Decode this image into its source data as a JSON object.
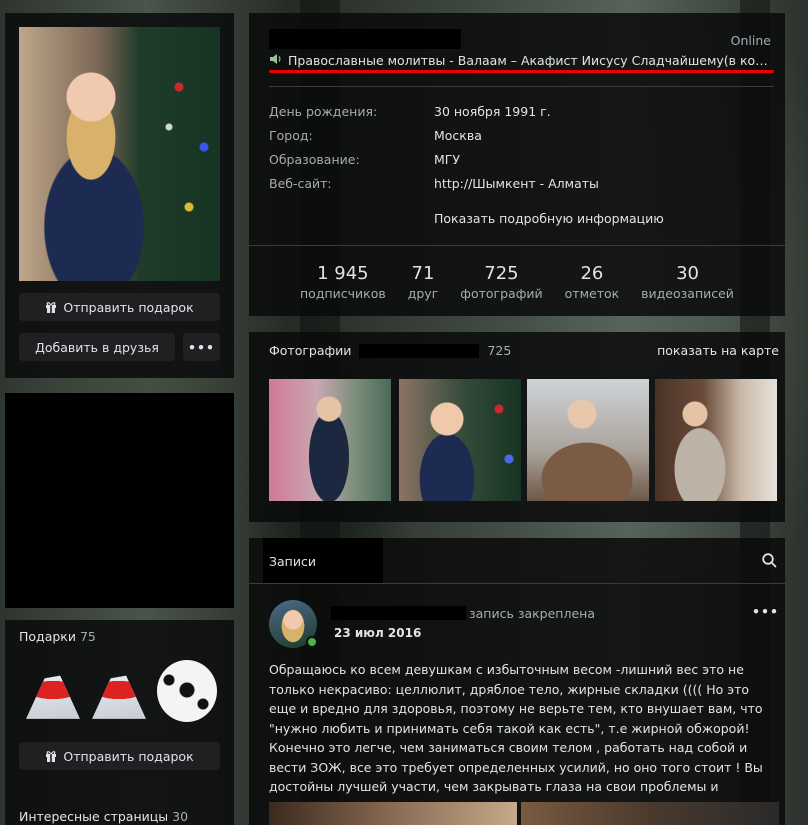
{
  "left": {
    "send_gift_label": "Отправить подарок",
    "add_friend_label": "Добавить в друзья",
    "more_label": "•••",
    "gifts": {
      "title": "Подарки",
      "count": "75",
      "send_label": "Отправить подарок"
    },
    "interesting_pages": {
      "title": "Интересные страницы",
      "count": "30"
    }
  },
  "profile": {
    "online_status": "Online",
    "status_text": "Православные молитвы - Валаам – Акафист Иисусу Сладчайшему(в конце а...",
    "info": [
      {
        "label": "День рождения:",
        "value": "30 ноября 1991 г."
      },
      {
        "label": "Город:",
        "value": "Москва"
      },
      {
        "label": "Образование:",
        "value": "МГУ"
      },
      {
        "label": "Веб-сайт:",
        "value": "http://Шымкент - Алматы"
      }
    ],
    "show_more_label": "Показать подробную информацию",
    "counters": [
      {
        "value": "1 945",
        "label": "подписчиков"
      },
      {
        "value": "71",
        "label": "друг"
      },
      {
        "value": "725",
        "label": "фотографий"
      },
      {
        "value": "26",
        "label": "отметок"
      },
      {
        "value": "30",
        "label": "видеозаписей"
      }
    ]
  },
  "photos": {
    "title": "Фотографии",
    "count": "725",
    "map_label": "показать на карте"
  },
  "posts": {
    "title": "Записи",
    "pinned_label": "запись закреплена",
    "date": "23 июл 2016",
    "more_label": "•••",
    "text": "Обращаюсь ко всем девушкам с избыточным весом -лишний вес это не только некрасиво: целлюлит, дряблое тело, жирные складки (((( Но это еще и вредно для здоровья, поэтому не верьте тем, кто внушает вам, что \"нужно любить и принимать себя такой как есть\", т.е жирной обжорой! Конечно это легче, чем заниматься своим телом , работать над собой и вести ЗОЖ, все это требует определенных усилий, но оно того стоит ! Вы достойны лучшей участи, чем закрывать глаза на свои проблемы и продолжать жиреть дальше."
  },
  "colors": {
    "panel_bg": "#0a0b0c",
    "text": "#e1e3e6",
    "muted": "#a6acb3",
    "status_underline": "#ee0000",
    "online_dot": "#4bb34b"
  }
}
